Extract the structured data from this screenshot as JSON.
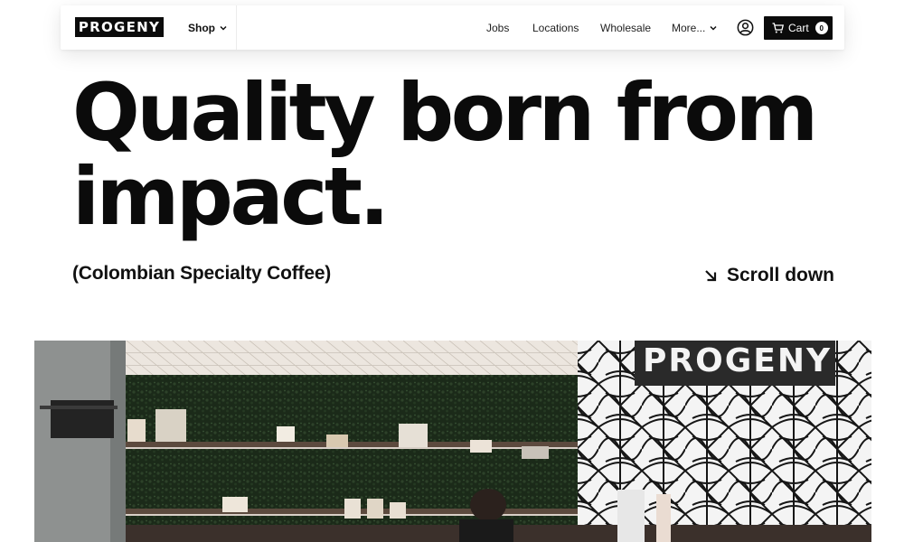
{
  "header": {
    "logo_text": "PROGENY",
    "shop_label": "Shop",
    "nav": {
      "jobs": "Jobs",
      "locations": "Locations",
      "wholesale": "Wholesale",
      "more": "More..."
    },
    "cart_label": "Cart",
    "cart_count": "0"
  },
  "hero": {
    "headline_line1": "Quality born from",
    "headline_line2": "impact.",
    "subtitle": "(Colombian Specialty Coffee)",
    "scroll_label": "Scroll down"
  },
  "photo": {
    "sign_text": "PROGENY"
  },
  "colors": {
    "text": "#0b0b0b",
    "background": "#ffffff",
    "cart_bg": "#0b0b0b"
  },
  "icons": [
    "chevron-down-icon",
    "account-icon",
    "cart-icon",
    "arrow-down-right-icon"
  ]
}
